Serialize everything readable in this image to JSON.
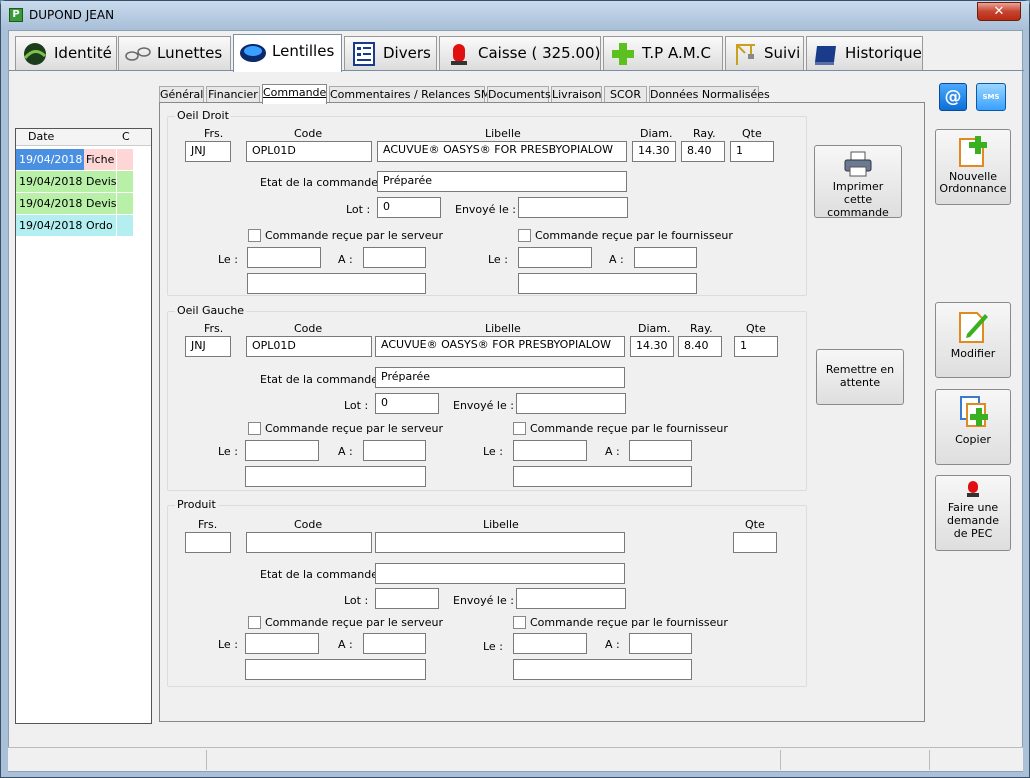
{
  "window": {
    "title": "DUPOND JEAN",
    "close_glyph": "✕"
  },
  "tabs": [
    {
      "label": "Identité",
      "icon": "identity-icon"
    },
    {
      "label": "Lunettes",
      "icon": "glasses-icon"
    },
    {
      "label": "Lentilles",
      "icon": "lens-icon"
    },
    {
      "label": "Divers",
      "icon": "form-icon"
    },
    {
      "label": "Caisse ( 325.00)",
      "icon": "alarm-icon"
    },
    {
      "label": "T.P A.M.C",
      "icon": "plus-icon"
    },
    {
      "label": "Suivi",
      "icon": "crane-icon"
    },
    {
      "label": "Historique",
      "icon": "book-icon"
    }
  ],
  "history": {
    "headers": {
      "date": "Date",
      "c": "C"
    },
    "rows": [
      {
        "date": "19/04/2018",
        "type": "Fiche",
        "color": "#ffd6d6",
        "date_bg": "#4a90e2"
      },
      {
        "date": "19/04/2018",
        "type": "Devis",
        "color": "#b8f0a8",
        "date_bg": "#b8f0a8"
      },
      {
        "date": "19/04/2018",
        "type": "Devis",
        "color": "#b8f0a8",
        "date_bg": "#b8f0a8"
      },
      {
        "date": "19/04/2018",
        "type": "Ordo",
        "color": "#b3eef0",
        "date_bg": "#b3eef0"
      }
    ]
  },
  "subtabs": [
    "Général",
    "Financier",
    "Commande",
    "Commentaires / Relances SMS",
    "Documents",
    "Livraison",
    "SCOR",
    "Données Normalisées"
  ],
  "labels": {
    "frs": "Frs.",
    "code": "Code",
    "libelle": "Libelle",
    "diam": "Diam.",
    "ray": "Ray.",
    "qte": "Qte",
    "etat": "Etat de la commande :",
    "lot": "Lot :",
    "envoye": "Envoyé le :",
    "recu_serveur": "Commande reçue par le serveur",
    "recu_fournisseur": "Commande reçue par le fournisseur",
    "le": "Le :",
    "a": "A :"
  },
  "oeil_droit": {
    "title": "Oeil Droit",
    "frs": "JNJ",
    "code": "OPL01D",
    "libelle": "ACUVUE® OASYS® FOR PRESBYOPIALOW",
    "diam": "14.30",
    "ray": "8.40",
    "qte": "1",
    "etat": "Préparée",
    "lot": "0",
    "envoye": ""
  },
  "oeil_gauche": {
    "title": "Oeil Gauche",
    "frs": "JNJ",
    "code": "OPL01D",
    "libelle": "ACUVUE® OASYS® FOR PRESBYOPIALOW",
    "diam": "14.30",
    "ray": "8.40",
    "qte": "1",
    "etat": "Préparée",
    "lot": "0",
    "envoye": ""
  },
  "produit": {
    "title": "Produit",
    "frs": "",
    "code": "",
    "libelle": "",
    "qte": "",
    "etat": "",
    "lot": "",
    "envoye": ""
  },
  "buttons": {
    "imprimer": "Imprimer cette commande",
    "remettre": "Remettre en attente",
    "nouvelle": "Nouvelle Ordonnance",
    "modifier": "Modifier",
    "copier": "Copier",
    "pec": "Faire une demande de PEC",
    "email_glyph": "@",
    "sms_glyph": "SMS"
  },
  "colors": {
    "accent": "#0a6fd6"
  }
}
